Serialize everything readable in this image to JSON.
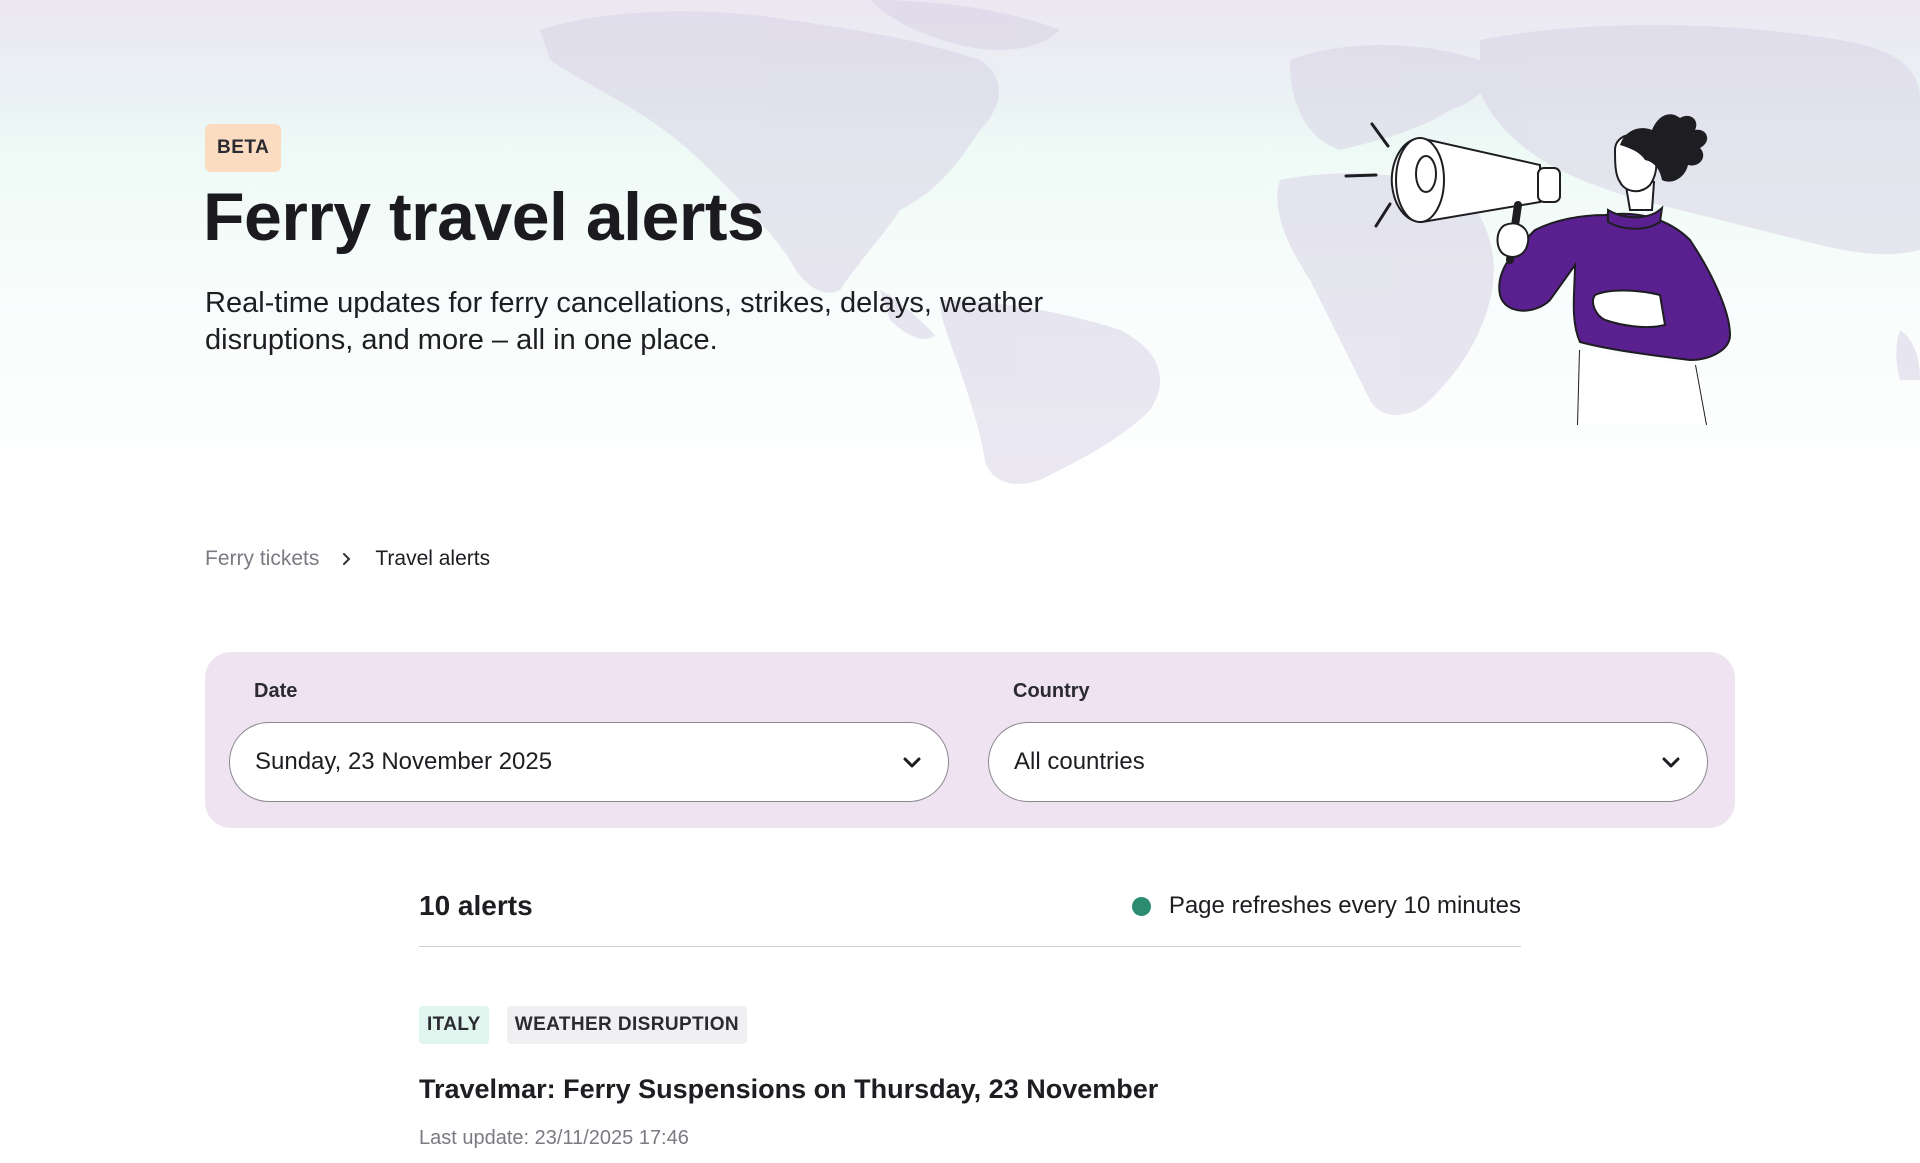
{
  "hero": {
    "badge": "BETA",
    "title": "Ferry travel alerts",
    "subtitle": "Real-time updates for ferry cancellations, strikes, delays, weather disruptions, and more – all in one place."
  },
  "breadcrumb": {
    "items": [
      "Ferry tickets",
      "Travel alerts"
    ]
  },
  "filters": {
    "date": {
      "label": "Date",
      "value": "Sunday, 23 November 2025"
    },
    "country": {
      "label": "Country",
      "value": "All countries"
    }
  },
  "results": {
    "count_text": "10 alerts",
    "refresh_text": "Page refreshes every 10 minutes"
  },
  "alerts": [
    {
      "tags": [
        "ITALY",
        "WEATHER DISRUPTION"
      ],
      "title": "Travelmar: Ferry Suspensions on Thursday, 23 November",
      "last_update": "Last update: 23/11/2025 17:46"
    }
  ],
  "colors": {
    "accent_purple": "#5a2090",
    "filter_bg": "#efe3f1",
    "beta_bg": "#fbdcc0",
    "live_dot": "#2c8c70",
    "country_tag_bg": "#dff5ee"
  },
  "icons": [
    "world-map",
    "megaphone-person-illustration",
    "chevron-right-icon",
    "chevron-down-icon"
  ]
}
